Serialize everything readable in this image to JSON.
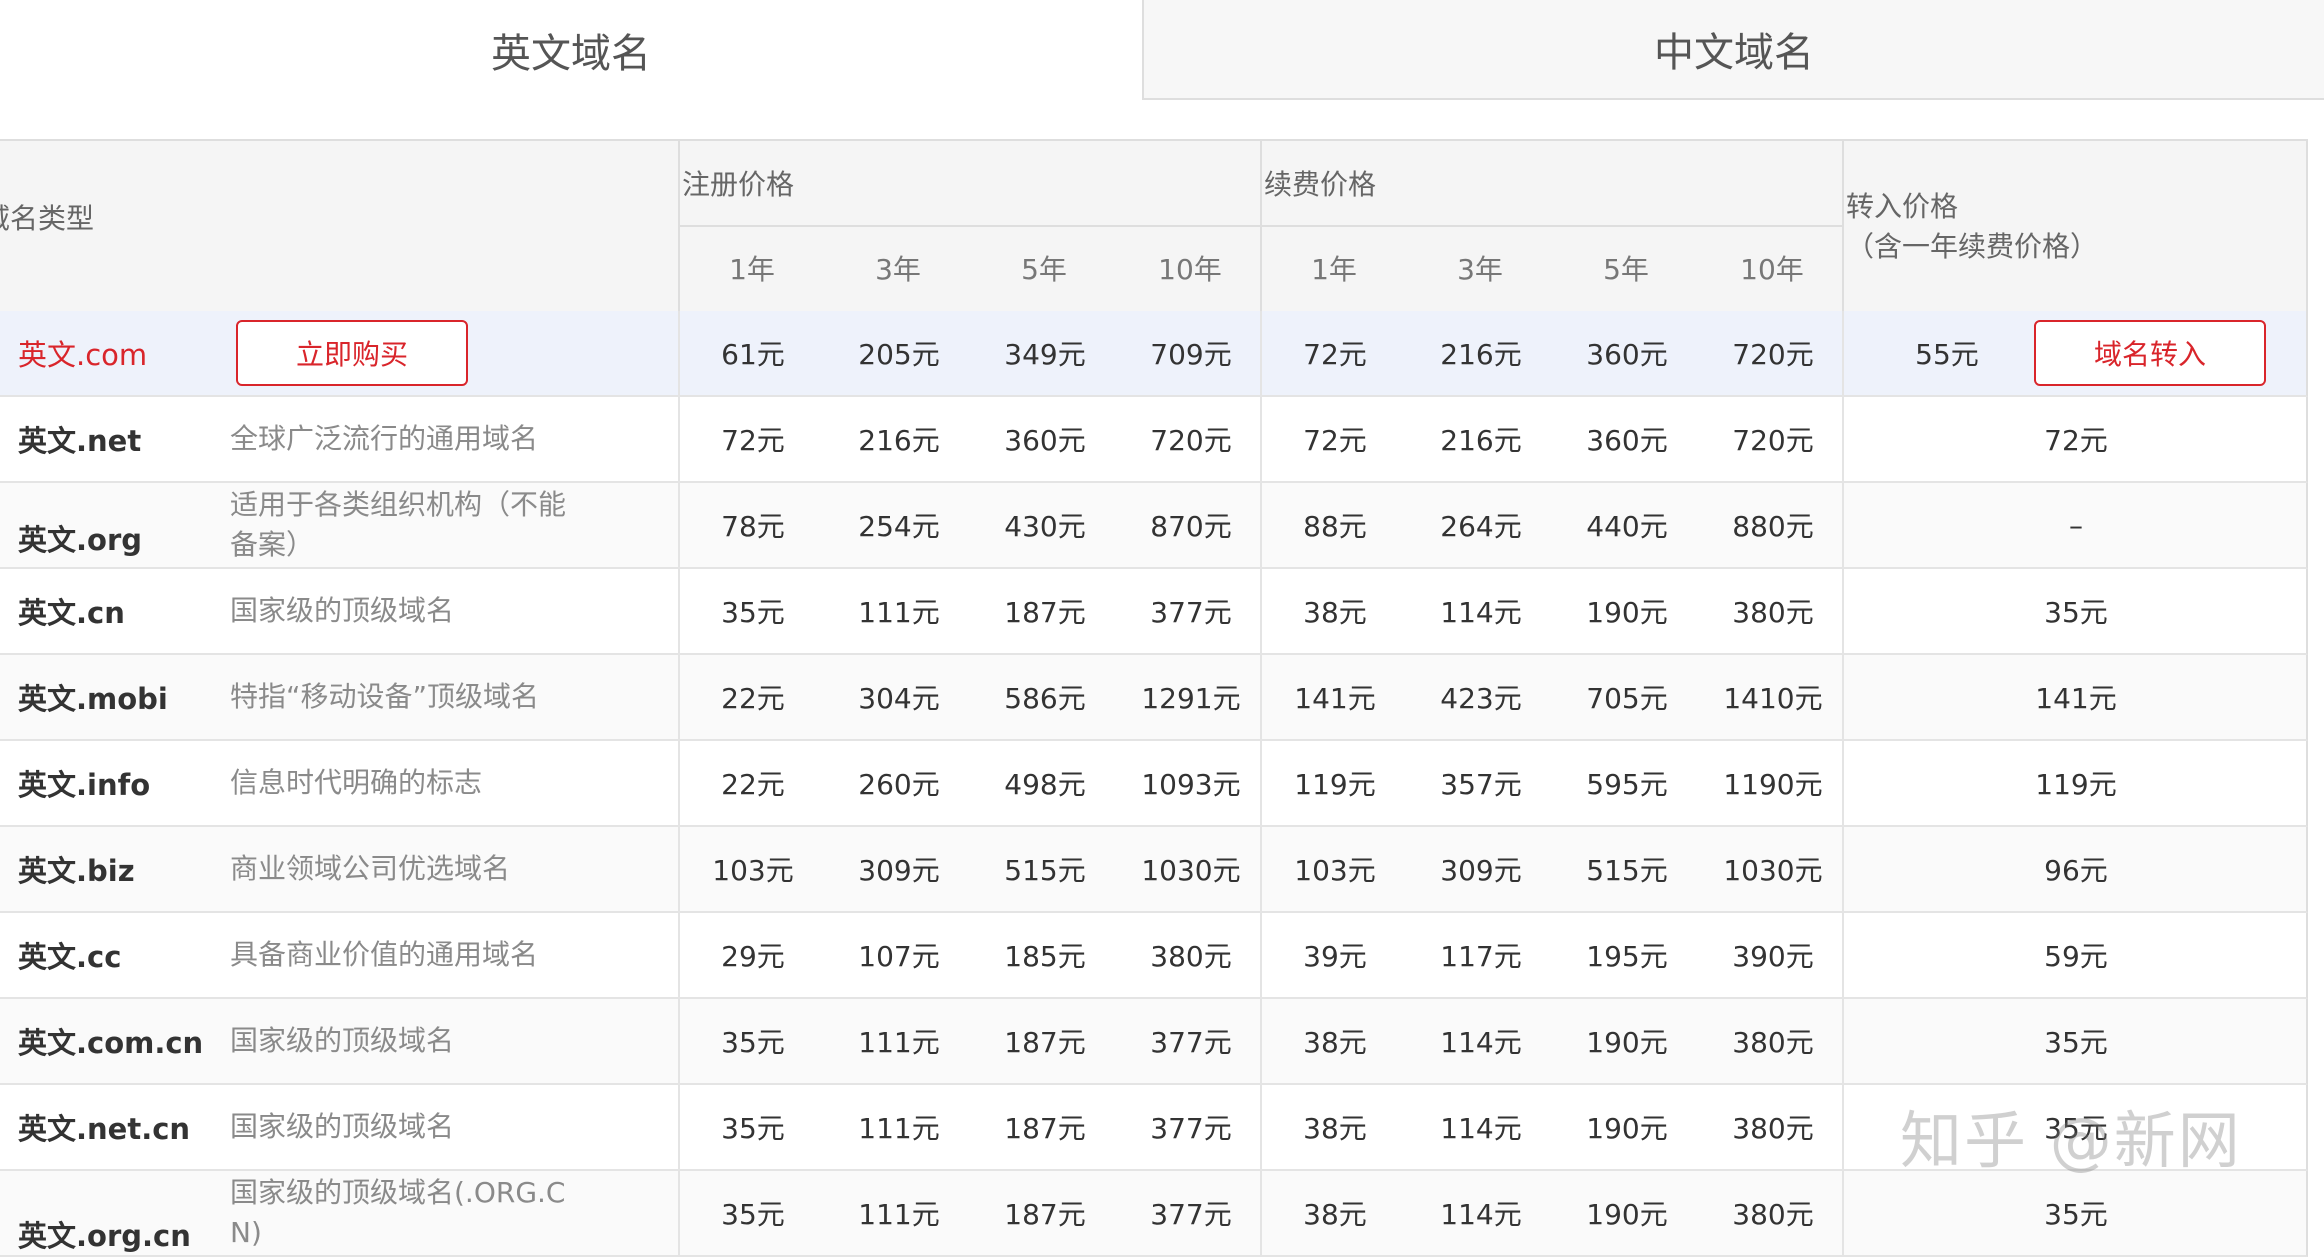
{
  "tabs": [
    {
      "label": "英文域名",
      "active": true
    },
    {
      "label": "中文域名",
      "active": false
    }
  ],
  "header": {
    "type_label": "域名类型",
    "register_label": "注册价格",
    "renew_label": "续费价格",
    "transfer_label": "转入价格",
    "transfer_sub": "（含一年续费价格）",
    "years": [
      "1年",
      "3年",
      "5年",
      "10年"
    ]
  },
  "buttons": {
    "buy": "立即购买",
    "transfer": "域名转入"
  },
  "rows": [
    {
      "name": "英文.com",
      "desc": "",
      "register": [
        "61元",
        "205元",
        "349元",
        "709元"
      ],
      "renew": [
        "72元",
        "216元",
        "360元",
        "720元"
      ],
      "transfer": "55元"
    },
    {
      "name": "英文.net",
      "desc": "全球广泛流行的通用域名",
      "register": [
        "72元",
        "216元",
        "360元",
        "720元"
      ],
      "renew": [
        "72元",
        "216元",
        "360元",
        "720元"
      ],
      "transfer": "72元"
    },
    {
      "name": "英文.org",
      "desc": "适用于各类组织机构（不能备案）",
      "register": [
        "78元",
        "254元",
        "430元",
        "870元"
      ],
      "renew": [
        "88元",
        "264元",
        "440元",
        "880元"
      ],
      "transfer": "–"
    },
    {
      "name": "英文.cn",
      "desc": "国家级的顶级域名",
      "register": [
        "35元",
        "111元",
        "187元",
        "377元"
      ],
      "renew": [
        "38元",
        "114元",
        "190元",
        "380元"
      ],
      "transfer": "35元"
    },
    {
      "name": "英文.mobi",
      "desc": "特指“移动设备”顶级域名",
      "register": [
        "22元",
        "304元",
        "586元",
        "1291元"
      ],
      "renew": [
        "141元",
        "423元",
        "705元",
        "1410元"
      ],
      "transfer": "141元"
    },
    {
      "name": "英文.info",
      "desc": "信息时代明确的标志",
      "register": [
        "22元",
        "260元",
        "498元",
        "1093元"
      ],
      "renew": [
        "119元",
        "357元",
        "595元",
        "1190元"
      ],
      "transfer": "119元"
    },
    {
      "name": "英文.biz",
      "desc": "商业领域公司优选域名",
      "register": [
        "103元",
        "309元",
        "515元",
        "1030元"
      ],
      "renew": [
        "103元",
        "309元",
        "515元",
        "1030元"
      ],
      "transfer": "96元"
    },
    {
      "name": "英文.cc",
      "desc": "具备商业价值的通用域名",
      "register": [
        "29元",
        "107元",
        "185元",
        "380元"
      ],
      "renew": [
        "39元",
        "117元",
        "195元",
        "390元"
      ],
      "transfer": "59元"
    },
    {
      "name": "英文.com.cn",
      "desc": "国家级的顶级域名",
      "register": [
        "35元",
        "111元",
        "187元",
        "377元"
      ],
      "renew": [
        "38元",
        "114元",
        "190元",
        "380元"
      ],
      "transfer": "35元"
    },
    {
      "name": "英文.net.cn",
      "desc": "国家级的顶级域名",
      "register": [
        "35元",
        "111元",
        "187元",
        "377元"
      ],
      "renew": [
        "38元",
        "114元",
        "190元",
        "380元"
      ],
      "transfer": "35元"
    },
    {
      "name": "英文.org.cn",
      "desc": "国家级的顶级域名(.ORG.CN)",
      "register": [
        "35元",
        "111元",
        "187元",
        "377元"
      ],
      "renew": [
        "38元",
        "114元",
        "190元",
        "380元"
      ],
      "transfer": "35元"
    }
  ],
  "watermark": "知乎 @新网",
  "colors": {
    "accent": "#d9252b",
    "highlight_row": "#eef2fb",
    "header_bg": "#f5f5f5"
  }
}
